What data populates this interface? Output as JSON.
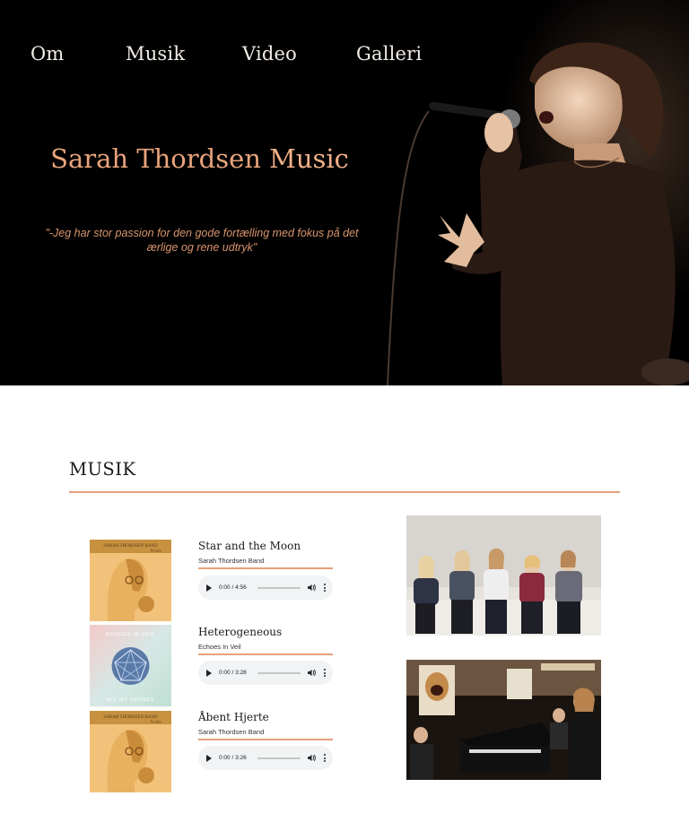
{
  "nav": {
    "items": [
      "Om",
      "Musik",
      "Video",
      "Galleri"
    ]
  },
  "hero": {
    "title_light": "Sarah Thordsen",
    "title_strong": "Music",
    "tagline": "\"-Jeg har stor passion for den gode fortælling med fokus på det ærlige og rene udtryk\""
  },
  "music": {
    "heading": "MUSIK",
    "tracks": [
      {
        "title": "Star and the Moon",
        "artist": "Sarah Thordsen Band",
        "time": "0:00 / 4:56",
        "cover": "sarah-thordsen-band-cover"
      },
      {
        "title": "Heterogeneous",
        "artist": "Echoes In Veil",
        "time": "0:00 / 3:28",
        "cover": "echoes-in-veil-cover"
      },
      {
        "title": "Åbent Hjerte",
        "artist": "Sarah Thordsen Band",
        "time": "0:00 / 3:26",
        "cover": "sarah-thordsen-band-cover"
      }
    ],
    "cover_text": {
      "band": "SARAH THORDSEN BAND",
      "band_sub": "Novalis",
      "echoes_top": "ECHOES IN VEIL",
      "echoes_bottom": "ALL MY SENSES"
    }
  },
  "colors": {
    "accent": "#e9a07c",
    "hero_bg": "#000000",
    "nav_text": "#f2ece6",
    "player_bg": "#f1f3f4"
  }
}
